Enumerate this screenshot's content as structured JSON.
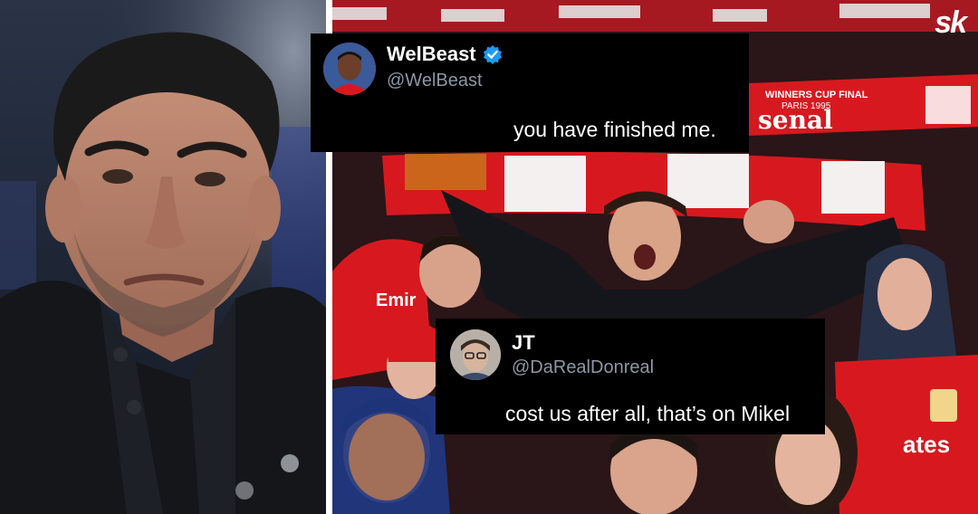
{
  "tweets": [
    {
      "name": "WelBeast",
      "handle": "@WelBeast",
      "text": "you have finished me.",
      "verified": true
    },
    {
      "name": "JT",
      "handle": "@DaRealDonreal",
      "text": "cost us after all, that’s on Mikel",
      "verified": false
    }
  ],
  "photo_text": {
    "scarf_top": "WINNERS CUP FINAL",
    "scarf_top_year": "PARIS 1995",
    "scarf_top_name": "senal",
    "shirt_left": "Emir",
    "shirt_right": "ates"
  },
  "brand": {
    "logo_text": "sk"
  },
  "colors": {
    "arsenal_red": "#d7191f",
    "tweet_bg": "#000000",
    "handle_gray": "#8b98a5",
    "verified_blue": "#1d9bf0"
  }
}
